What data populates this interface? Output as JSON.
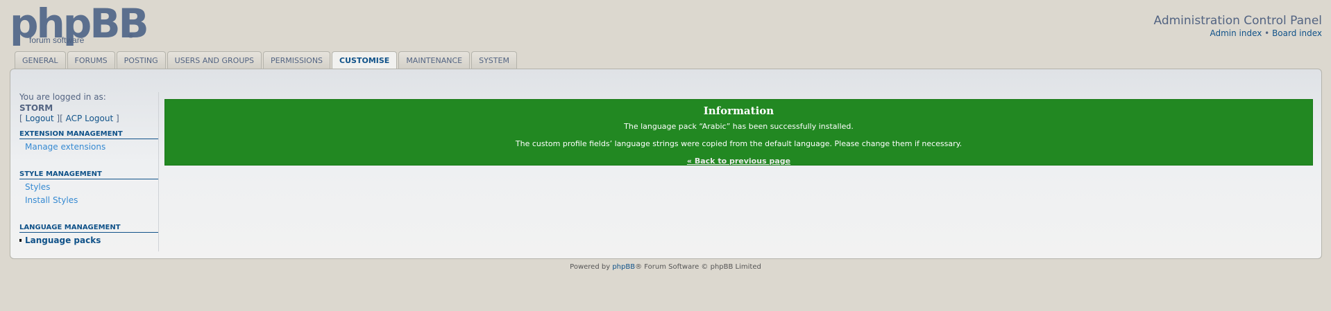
{
  "header": {
    "logo_text": "phpBB",
    "logo_subtext": "forum software",
    "logo_reg": "®",
    "title": "Administration Control Panel",
    "links": {
      "admin_index": "Admin index",
      "separator": "•",
      "board_index": "Board index"
    }
  },
  "tabs": [
    {
      "label": "GENERAL",
      "active": false
    },
    {
      "label": "FORUMS",
      "active": false
    },
    {
      "label": "POSTING",
      "active": false
    },
    {
      "label": "USERS AND GROUPS",
      "active": false
    },
    {
      "label": "PERMISSIONS",
      "active": false
    },
    {
      "label": "CUSTOMISE",
      "active": true
    },
    {
      "label": "MAINTENANCE",
      "active": false
    },
    {
      "label": "SYSTEM",
      "active": false
    }
  ],
  "sidebar": {
    "logged_in_label": "You are logged in as:",
    "username": "STORM",
    "bracket_open": "[",
    "logout": "Logout",
    "bracket_mid": "][",
    "acp_logout": "ACP Logout",
    "bracket_close": "]",
    "sections": [
      {
        "title": "EXTENSION MANAGEMENT",
        "items": [
          "Manage extensions"
        ]
      },
      {
        "title": "STYLE MANAGEMENT",
        "items": [
          "Styles",
          "Install Styles"
        ]
      },
      {
        "title": "LANGUAGE MANAGEMENT",
        "items": [
          "Language packs"
        ]
      }
    ]
  },
  "info": {
    "title": "Information",
    "line1": "The language pack “Arabic” has been successfully installed.",
    "line2": "The custom profile fields’ language strings were copied from the default language. Please change them if necessary.",
    "back_link": "« Back to previous page",
    "bg_color": "#228822"
  },
  "footer": {
    "powered_by": "Powered by",
    "phpbb": "phpBB",
    "rest": "® Forum Software © phpBB Limited"
  }
}
